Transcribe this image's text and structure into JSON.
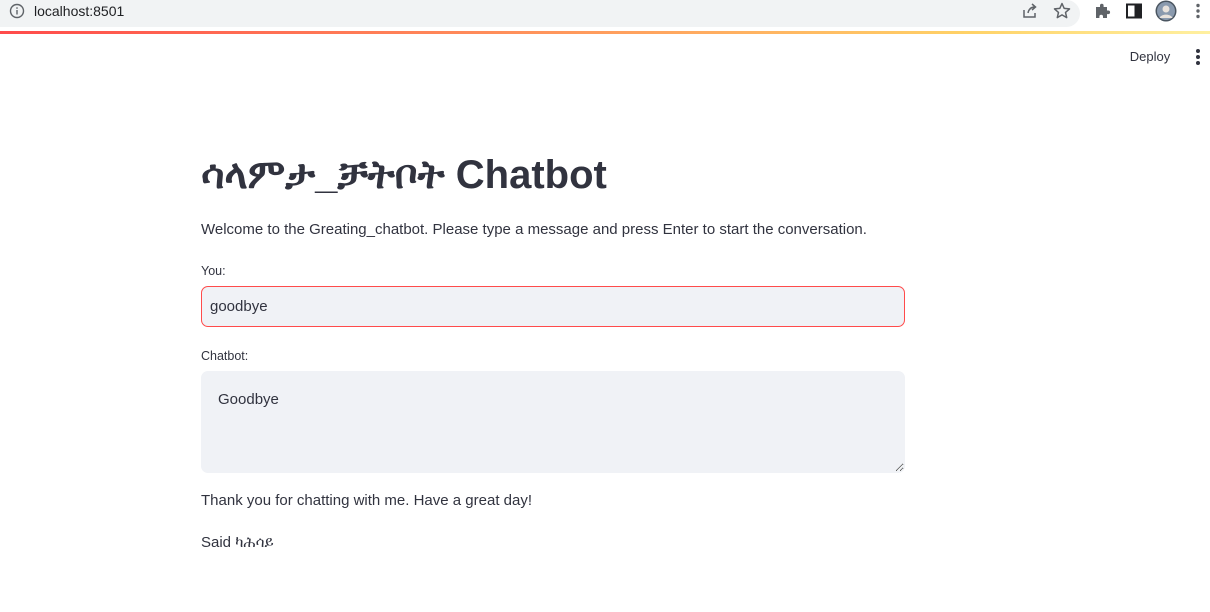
{
  "browser": {
    "url": "localhost:8501",
    "icons": [
      "info-icon",
      "share-icon",
      "star-icon",
      "extensions-icon",
      "sidepanel-icon",
      "profile-avatar",
      "more-vert-icon"
    ]
  },
  "header": {
    "deploy_label": "Deploy",
    "menu_icon": "more-vert-icon",
    "accent_color": "#ff4b4b"
  },
  "main": {
    "title": "ሳላምታ_ቻትቦት Chatbot",
    "welcome": "Welcome to the Greating_chatbot. Please type a message and press Enter to start the conversation.",
    "you_label": "You:",
    "you_value": "goodbye",
    "chatbot_label": "Chatbot:",
    "chatbot_value": "Goodbye",
    "thanks": "Thank you for chatting with me. Have a great day!",
    "said": "Said ካሕሳይ"
  }
}
